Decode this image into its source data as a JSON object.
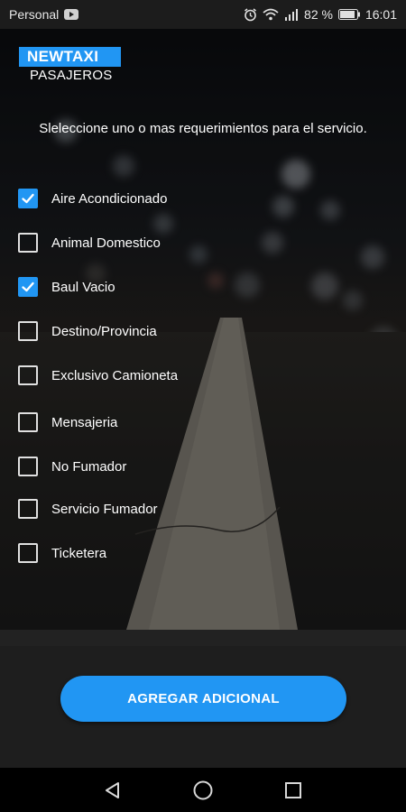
{
  "status_bar": {
    "carrier": "Personal",
    "battery": "82 %",
    "time": "16:01",
    "icons": [
      "youtube-icon",
      "alarm-icon",
      "wifi-icon",
      "signal-icon",
      "battery-icon"
    ]
  },
  "logo": {
    "brand": "NEWTAXI",
    "subtitle": "PASAJEROS"
  },
  "instruction": "Sleleccione uno o mas requerimientos para el servicio.",
  "options": [
    {
      "label": "Aire Acondicionado",
      "checked": true
    },
    {
      "label": "Animal Domestico",
      "checked": false
    },
    {
      "label": "Baul Vacio",
      "checked": true
    },
    {
      "label": "Destino/Provincia",
      "checked": false
    },
    {
      "label": "Exclusivo Camioneta",
      "checked": false
    },
    {
      "label": "Mensajeria",
      "checked": false
    },
    {
      "label": "No Fumador",
      "checked": false
    },
    {
      "label": "Servicio Fumador",
      "checked": false
    },
    {
      "label": "Ticketera",
      "checked": false
    }
  ],
  "button": {
    "label": "AGREGAR ADICIONAL"
  },
  "colors": {
    "accent": "#2196f3",
    "bottom_panel": "#1e1e1e"
  },
  "nav": [
    "back-icon",
    "home-icon",
    "recents-icon"
  ]
}
